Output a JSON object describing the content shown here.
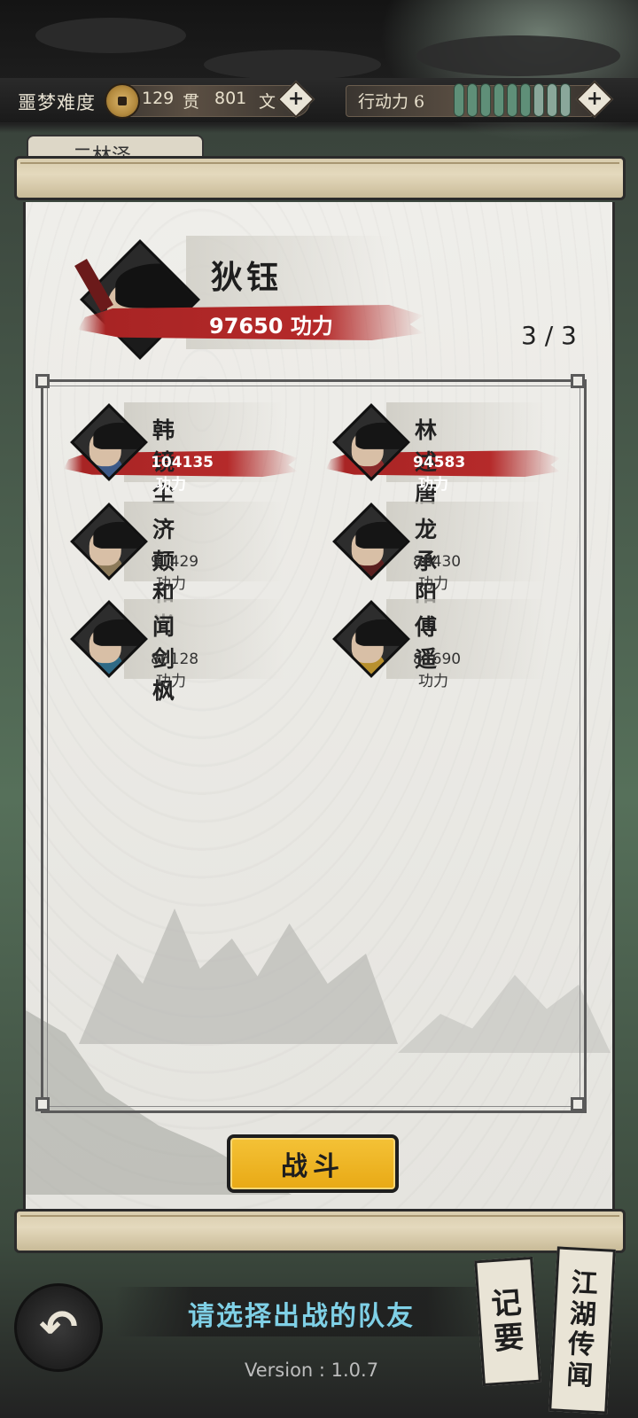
{
  "header": {
    "difficulty_label": "噩梦难度",
    "money": {
      "guan_amount": "129",
      "guan_unit": "贯",
      "wen_amount": "801",
      "wen_unit": "文"
    },
    "action_points_label": "行动力 6",
    "action_points": {
      "current": 6,
      "segments": 9
    }
  },
  "background_tab": {
    "label": "二林泽"
  },
  "leader": {
    "name": "狄钰",
    "power": "97650",
    "power_unit": "功力"
  },
  "team_counter": "3 / 3",
  "companions": [
    {
      "name": "韩镜尘",
      "power": "104135",
      "power_unit": "功力",
      "selected": true,
      "robe_color": "#3d5a88"
    },
    {
      "name": "林述唐",
      "power": "94583",
      "power_unit": "功力",
      "selected": true,
      "robe_color": "#8a2a2a"
    },
    {
      "name": "济颠和尚",
      "power": "91429",
      "power_unit": "功力",
      "selected": false,
      "robe_color": "#8c7a5a"
    },
    {
      "name": "龙承阳",
      "power": "86430",
      "power_unit": "功力",
      "selected": false,
      "robe_color": "#5a1f1f"
    },
    {
      "name": "闻剑枫",
      "power": "86128",
      "power_unit": "功力",
      "selected": false,
      "robe_color": "#2f6a86"
    },
    {
      "name": "傅遥",
      "power": "81690",
      "power_unit": "功力",
      "selected": false,
      "robe_color": "#b8902e"
    }
  ],
  "fight_button": {
    "label": "战斗"
  },
  "hint": "请选择出战的队友",
  "side_buttons": {
    "notes": "记要",
    "rumors": "江湖传闻"
  },
  "back_icon": "undo-arrow-icon",
  "version": "Version : 1.0.7",
  "colors": {
    "accent_red": "#a82424",
    "button_yellow": "#f0b828",
    "hint_cyan": "#7fd0e6",
    "ap_green": "#5f8f78"
  }
}
